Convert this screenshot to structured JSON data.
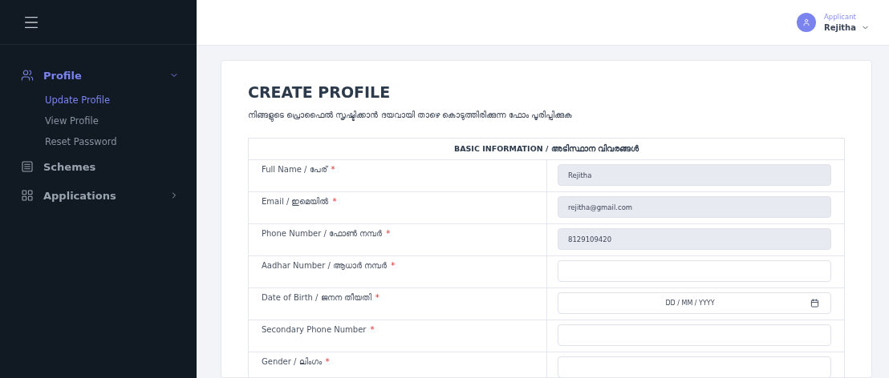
{
  "user": {
    "role": "Applicant",
    "name": "Rejitha"
  },
  "sidebar": {
    "items": [
      {
        "label": "Profile",
        "expanded": true,
        "selected": true,
        "children": [
          {
            "label": "Update Profile",
            "selected": true
          },
          {
            "label": "View Profile",
            "selected": false
          },
          {
            "label": "Reset Password",
            "selected": false
          }
        ]
      },
      {
        "label": "Schemes",
        "selected": false
      },
      {
        "label": "Applications",
        "expanded": false,
        "selected": false
      }
    ]
  },
  "page": {
    "title": "CREATE PROFILE",
    "subtitle": "നിങ്ങളുടെ പ്രൊഫൈൽ സൃഷ്ടിക്കാൻ ദയവായി താഴെ കൊടുത്തിരിക്കുന്ന ഫോം പൂരിപ്പിക്കുക"
  },
  "form": {
    "section": "BASIC INFORMATION / അടിസ്ഥാന വിവരങ്ങൾ",
    "rows": [
      {
        "label": "Full Name / പേര്",
        "required_mark": "*",
        "kind": "text",
        "disabled": true,
        "value": "Rejitha"
      },
      {
        "label": "Email / ഇമെയിൽ",
        "required_mark": "*",
        "kind": "text",
        "disabled": true,
        "value": "rejitha@gmail.com"
      },
      {
        "label": "Phone Number / ഫോൺ നമ്പർ",
        "required_mark": "*",
        "kind": "text",
        "disabled": true,
        "value": "8129109420"
      },
      {
        "label": "Aadhar Number / ആധാർ നമ്പർ",
        "required_mark": "*",
        "kind": "text",
        "disabled": false
      },
      {
        "label": "Date of Birth / ജനന തീയതി",
        "required_mark": "*",
        "kind": "date",
        "placeholder": "DD / MM / YYYY"
      },
      {
        "label": "Secondary Phone Number",
        "required_mark": "*",
        "kind": "text",
        "disabled": false
      },
      {
        "label": "Gender / ലിംഗം",
        "required_mark": "*",
        "kind": "text",
        "disabled": false
      }
    ]
  }
}
